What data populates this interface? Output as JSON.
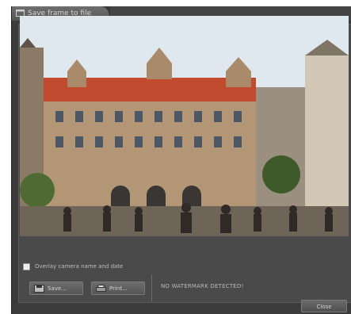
{
  "window": {
    "title": "Save frame to file"
  },
  "options": {
    "overlay_label": "Overlay camera name and date",
    "overlay_checked": false
  },
  "actions": {
    "save_label": "Save...",
    "print_label": "Print..."
  },
  "status": {
    "watermark": "NO WATERMARK DETECTED!"
  },
  "footer": {
    "close_label": "Close"
  },
  "icons": {
    "title": "window-icon",
    "save": "floppy-disk-icon",
    "print": "printer-icon"
  },
  "colors": {
    "window_bg": "#3b3b3b",
    "panel_bg": "#4a4a4a",
    "text": "#bdbdbd"
  }
}
